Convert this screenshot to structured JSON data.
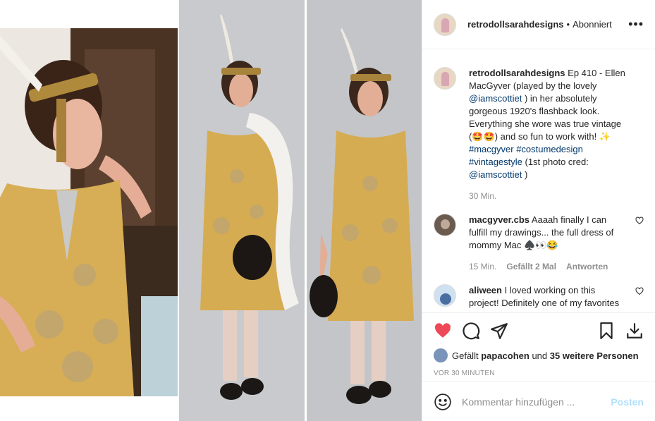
{
  "post": {
    "username": "retrodollsarahdesigns",
    "separator": "•",
    "follow_status": "Abonniert",
    "more_label": "•••"
  },
  "caption": {
    "username": "retrodollsarahdesigns",
    "text_1": "Ep 410 - Ellen MacGyver (played by the lovely ",
    "mention_1": "@iamscottiet",
    "text_2": " ) in her absolutely gorgeous 1920's flashback look. Everything she wore was true vintage (🤩🤩) and so fun to work with! ✨ ",
    "tag_1": "#macgyver",
    "tag_2": "#costumedesign",
    "tag_3": "#vintagestyle",
    "text_3": " (1st photo cred: ",
    "mention_2": "@iamscottiet",
    "text_4": " )",
    "time": "30 Min."
  },
  "comments": [
    {
      "username": "macgyver.cbs",
      "text": "Aaaah finally I can fulfill my drawings... the full dress of mommy Mac ♠️👀😂",
      "time": "15 Min.",
      "likes": "Gefällt 2 Mal",
      "reply": "Antworten"
    },
    {
      "username": "aliween",
      "text": "I loved working on this project! Definitely one of my favorites",
      "time": "",
      "likes": "",
      "reply": ""
    }
  ],
  "likes": {
    "prefix": "Gefällt ",
    "user": "papacohen",
    "middle": " und ",
    "others": "35 weitere Personen"
  },
  "timestamp": "VOR 30 MINUTEN",
  "add_comment": {
    "placeholder": "Kommentar hinzufügen ...",
    "post_label": "Posten"
  },
  "colors": {
    "like_red": "#ed4956",
    "link_blue": "#00376b",
    "post_disabled": "#b2dffc"
  },
  "icons": [
    "heart-icon",
    "comment-icon",
    "share-icon",
    "bookmark-icon",
    "download-icon",
    "emoji-icon"
  ]
}
